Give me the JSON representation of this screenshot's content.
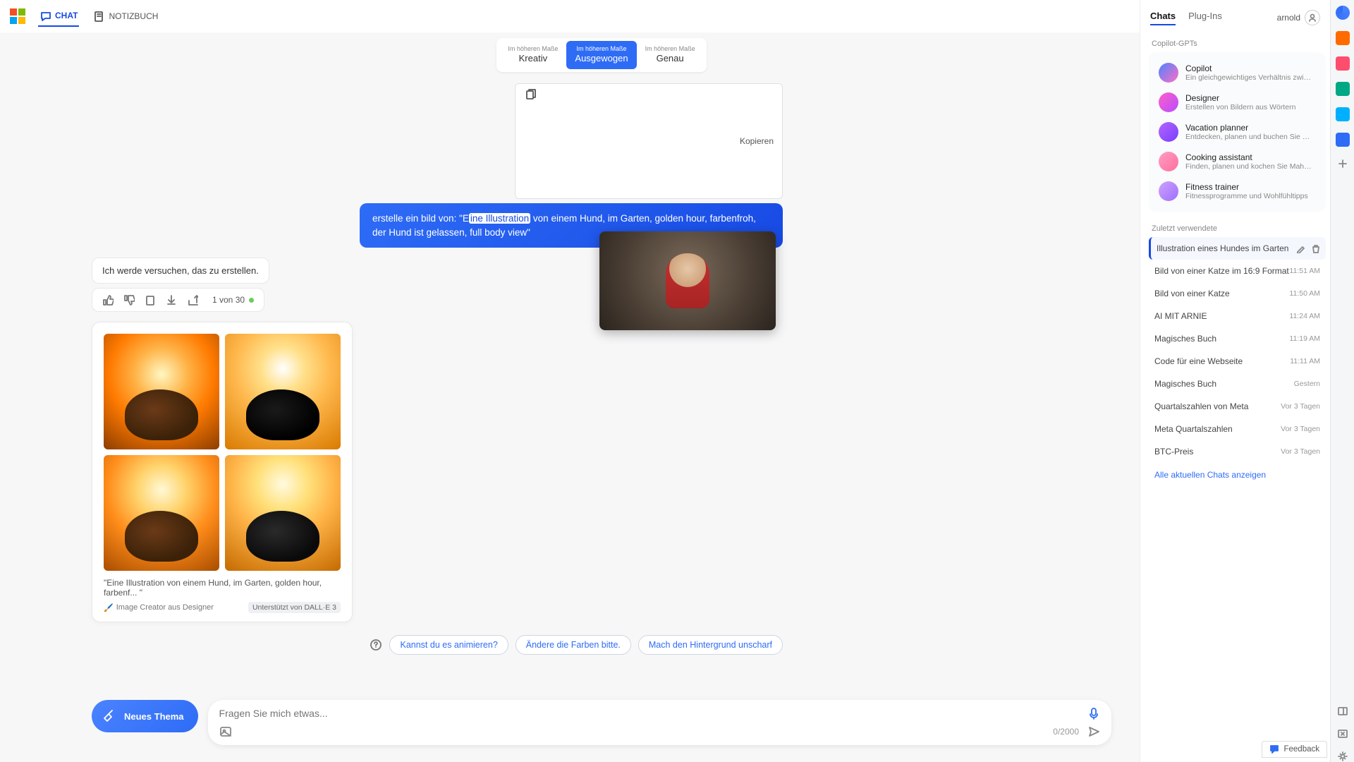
{
  "top": {
    "chatTab": "CHAT",
    "notebookTab": "NOTIZBUCH"
  },
  "styles": {
    "sup": "Im höheren Maße",
    "opt1": "Kreativ",
    "opt2": "Ausgewogen",
    "opt3": "Genau"
  },
  "copyLabel": "Kopieren",
  "prompt": {
    "pre": "erstelle ein bild von: \"E",
    "hl": "ine Illustration",
    "post": " von einem Hund, im Garten, golden hour, farbenfroh, der Hund ist gelassen, full body view\""
  },
  "response": "Ich werde versuchen, das zu erstellen.",
  "counter": "1 von 30",
  "gallery": {
    "caption": "\"Eine Illustration von einem Hund, im Garten, golden hour, farbenf... \"",
    "creator": "Image Creator aus Designer",
    "badge": "Unterstützt von DALL·E 3"
  },
  "suggestions": {
    "s1": "Kannst du es animieren?",
    "s2": "Ändere die Farben bitte.",
    "s3": "Mach den Hintergrund unscharf"
  },
  "newTopic": "Neues Thema",
  "composer": {
    "placeholder": "Fragen Sie mich etwas...",
    "limit": "0/2000"
  },
  "right": {
    "tabChats": "Chats",
    "tabPlugins": "Plug-Ins",
    "user": "arnold",
    "sect1": "Copilot-GPTs",
    "gpts": [
      {
        "name": "Copilot",
        "desc": "Ein gleichgewichtiges Verhältnis zwischen KI u",
        "c1": "#4b83ff",
        "c2": "#ff6ec7"
      },
      {
        "name": "Designer",
        "desc": "Erstellen von Bildern aus Wörtern",
        "c1": "#ff5ec7",
        "c2": "#b84dff"
      },
      {
        "name": "Vacation planner",
        "desc": "Entdecken, planen und buchen Sie Reisen",
        "c1": "#b366ff",
        "c2": "#7a3dff"
      },
      {
        "name": "Cooking assistant",
        "desc": "Finden, planen und kochen Sie Mahlzeiten",
        "c1": "#ff9ec2",
        "c2": "#ff6e9e"
      },
      {
        "name": "Fitness trainer",
        "desc": "Fitnessprogramme und Wohlfühltipps",
        "c1": "#cba3ff",
        "c2": "#a06eff"
      }
    ],
    "sect2": "Zuletzt verwendete",
    "recents": [
      {
        "title": "Illustration eines Hundes im Garten",
        "ts": "",
        "active": true
      },
      {
        "title": "Bild von einer Katze im 16:9 Format",
        "ts": "11:51 AM"
      },
      {
        "title": "Bild von einer Katze",
        "ts": "11:50 AM"
      },
      {
        "title": "AI MIT ARNIE",
        "ts": "11:24 AM"
      },
      {
        "title": "Magisches Buch",
        "ts": "11:19 AM"
      },
      {
        "title": "Code für eine Webseite",
        "ts": "11:11 AM"
      },
      {
        "title": "Magisches Buch",
        "ts": "Gestern"
      },
      {
        "title": "Quartalszahlen von Meta",
        "ts": "Vor 3 Tagen"
      },
      {
        "title": "Meta Quartalszahlen",
        "ts": "Vor 3 Tagen"
      },
      {
        "title": "BTC-Preis",
        "ts": "Vor 3 Tagen"
      }
    ],
    "viewAll": "Alle aktuellen Chats anzeigen"
  },
  "feedback": "Feedback"
}
